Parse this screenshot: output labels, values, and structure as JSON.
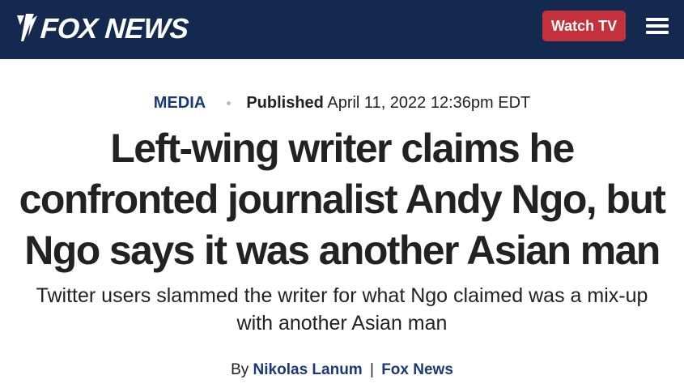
{
  "header": {
    "logo_text": "FOX NEWS",
    "watch_tv_label": "Watch TV",
    "menu_icon": "hamburger-menu-icon",
    "colors": {
      "background": "#13294f",
      "watch_tv_button": "#c4303b"
    }
  },
  "article": {
    "category": "MEDIA",
    "published_label": "Published",
    "published_date": "April 11, 2022 12:36pm EDT",
    "headline": "Left-wing writer claims he confronted journalist Andy Ngo, but Ngo says it was another Asian man",
    "subheadline": "Twitter users slammed the writer for what Ngo claimed was a mix-up with another Asian man",
    "byline": {
      "prefix": "By",
      "author": "Nikolas Lanum",
      "separator": "|",
      "source": "Fox News"
    },
    "accent_color": "#193a75"
  }
}
